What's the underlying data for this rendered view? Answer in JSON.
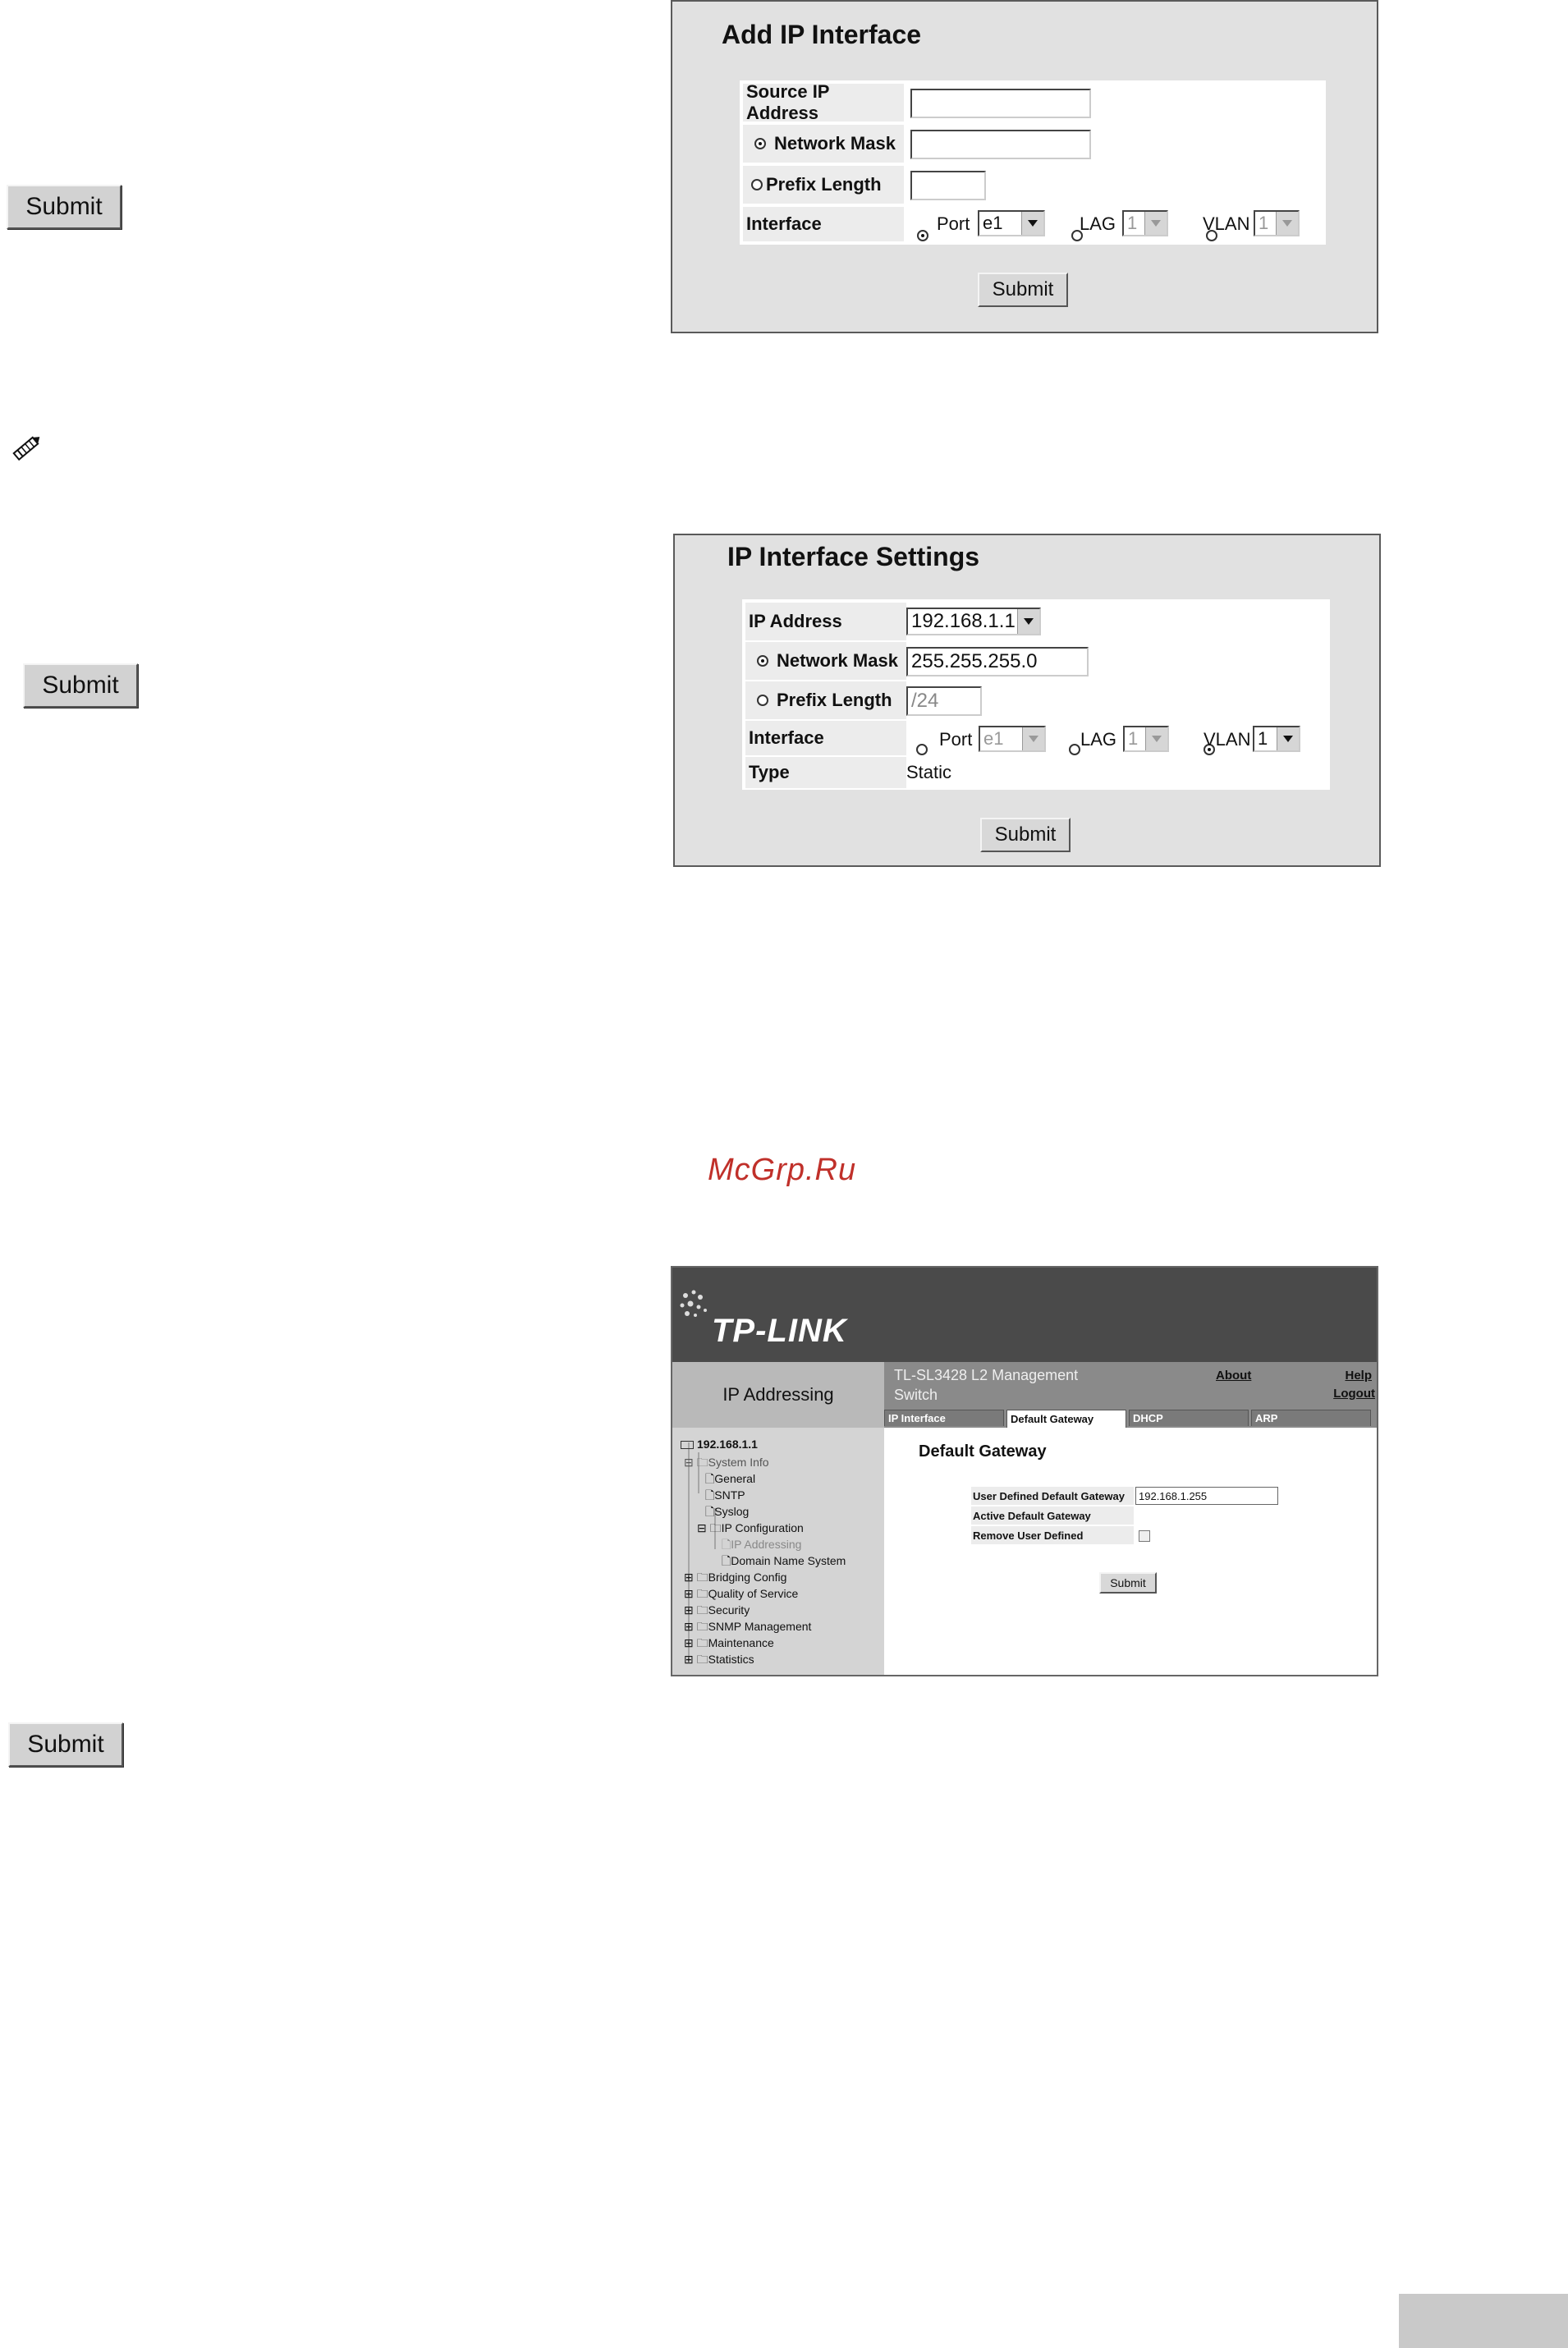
{
  "side_buttons": {
    "submit_1": "Submit",
    "submit_2": "Submit",
    "submit_3": "Submit"
  },
  "add_ip": {
    "title": "Add IP Interface",
    "source_ip_label": "Source IP Address",
    "source_ip_value": "",
    "network_mask_label": "Network Mask",
    "network_mask_value": "",
    "prefix_length_label": "Prefix Length",
    "prefix_length_value": "",
    "interface_label": "Interface",
    "port_label": "Port",
    "port_value": "e1",
    "lag_label": "LAG",
    "lag_value": "1",
    "vlan_label": "VLAN",
    "vlan_value": "1",
    "submit": "Submit"
  },
  "ip_settings": {
    "title": "IP Interface Settings",
    "ip_address_label": "IP Address",
    "ip_address_value": "192.168.1.1",
    "network_mask_label": "Network Mask",
    "network_mask_value": "255.255.255.0",
    "prefix_length_label": "Prefix Length",
    "prefix_length_value": "/24",
    "interface_label": "Interface",
    "port_label": "Port",
    "port_value": "e1",
    "lag_label": "LAG",
    "lag_value": "1",
    "vlan_label": "VLAN",
    "vlan_value": "1",
    "type_label": "Type",
    "type_value": "Static",
    "submit": "Submit"
  },
  "watermark": "McGrp.Ru",
  "tplink": {
    "logo": "TP-LINK",
    "section_title": "IP Addressing",
    "device_title": "TL-SL3428 L2 Management Switch",
    "links": {
      "about": "About",
      "help": "Help",
      "logout": "Logout"
    },
    "tabs": [
      "IP Interface",
      "Default Gateway",
      "DHCP",
      "ARP"
    ],
    "tree": {
      "root": "192.168.1.1",
      "system_info": "System Info",
      "general": "General",
      "sntp": "SNTP",
      "syslog": "Syslog",
      "ip_configuration": "IP Configuration",
      "ip_addressing": "IP Addressing",
      "domain_name_system": "Domain Name System",
      "bridging_config": "Bridging Config",
      "quality_of_service": "Quality of Service",
      "security": "Security",
      "snmp_management": "SNMP Management",
      "maintenance": "Maintenance",
      "statistics": "Statistics"
    },
    "content": {
      "heading": "Default Gateway",
      "user_defined_label": "User Defined Default Gateway",
      "user_defined_value": "192.168.1.255",
      "active_label": "Active Default Gateway",
      "remove_label": "Remove User Defined",
      "submit": "Submit"
    }
  },
  "colors": {
    "panel_bg": "#e1e1e1",
    "header_dark": "#4a4a4a",
    "watermark": "#c0302a"
  }
}
